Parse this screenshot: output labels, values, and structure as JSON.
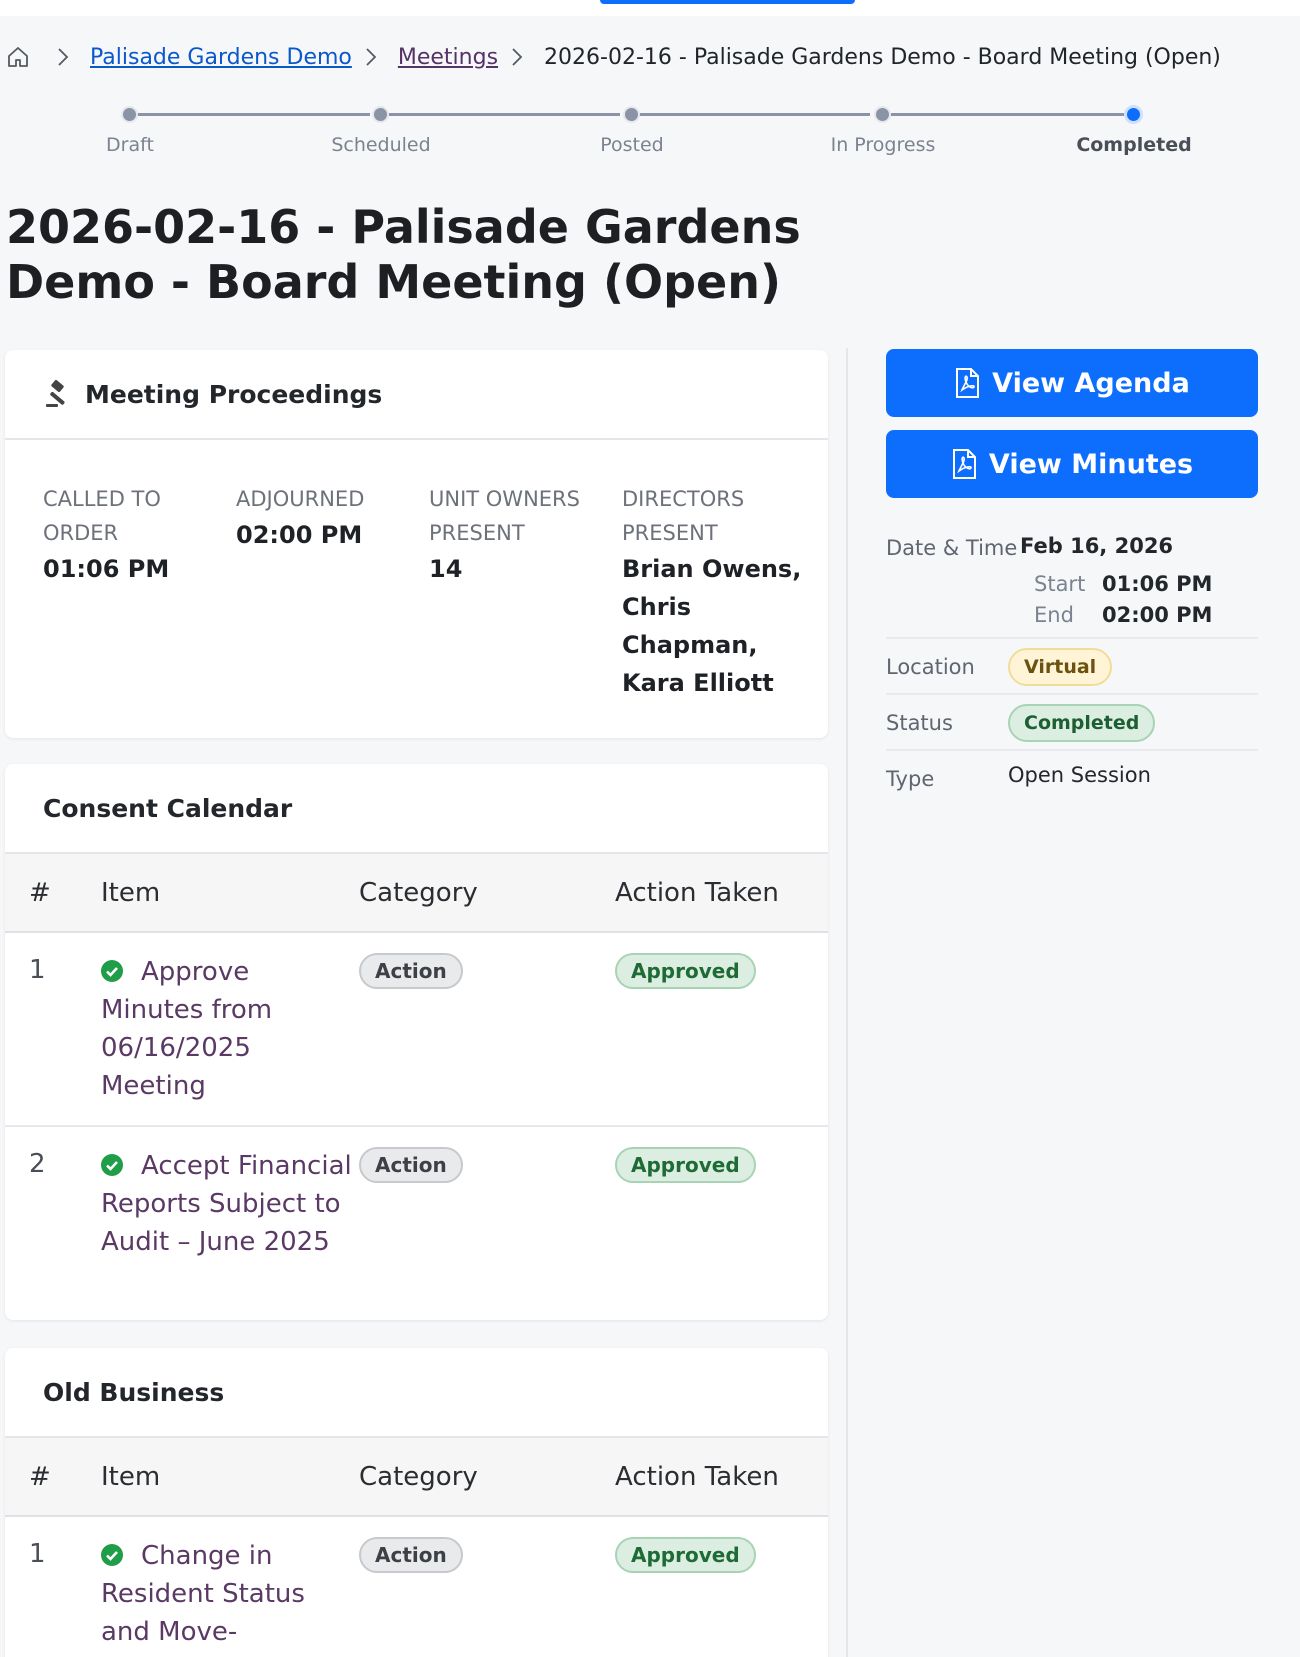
{
  "breadcrumb": {
    "home_icon": "home-icon",
    "items": [
      "Palisade Gardens Demo",
      "Meetings"
    ],
    "current": "2026-02-16 - Palisade Gardens Demo - Board Meeting (Open)"
  },
  "stepper": {
    "steps": [
      "Draft",
      "Scheduled",
      "Posted",
      "In Progress",
      "Completed"
    ],
    "active": "Completed"
  },
  "page": {
    "title": "2026-02-16 - Palisade Gardens Demo - Board Meeting (Open)"
  },
  "proceedings": {
    "title": "Meeting Proceedings",
    "icon": "gavel-icon",
    "called_to_order_label": "CALLED TO ORDER",
    "called_to_order_value": "01:06 PM",
    "adjourned_label": "ADJOURNED",
    "adjourned_value": "02:00 PM",
    "unit_owners_label": "UNIT OWNERS PRESENT",
    "unit_owners_value": "14",
    "directors_label": "DIRECTORS PRESENT",
    "directors_value": "Brian Owens, Chris Chapman, Kara Elliott"
  },
  "table_headers": [
    "#",
    "Item",
    "Category",
    "Action Taken"
  ],
  "consent_calendar": {
    "title": "Consent Calendar",
    "rows": [
      {
        "num": "1",
        "item": "Approve Minutes from 06/16/2025 Meeting",
        "category": "Action",
        "action": "Approved"
      },
      {
        "num": "2",
        "item": "Accept Financial Reports Subject to Audit – June 2025",
        "category": "Action",
        "action": "Approved"
      }
    ]
  },
  "old_business": {
    "title": "Old Business",
    "rows": [
      {
        "num": "1",
        "item": "Change in Resident Status and Move-",
        "category": "Action",
        "action": "Approved"
      }
    ]
  },
  "actions": {
    "view_agenda": "View Agenda",
    "view_minutes": "View Minutes"
  },
  "details": {
    "date_time_label": "Date & Time",
    "date": "Feb 16, 2026",
    "start_label": "Start",
    "start_value": "01:06 PM",
    "end_label": "End",
    "end_value": "02:00 PM",
    "location_label": "Location",
    "location_value": "Virtual",
    "status_label": "Status",
    "status_value": "Completed",
    "type_label": "Type",
    "type_value": "Open Session"
  },
  "colors": {
    "primary": "#0d6efd",
    "approved_bg": "#dbeee1",
    "virtual_bg": "#fff5d6"
  }
}
